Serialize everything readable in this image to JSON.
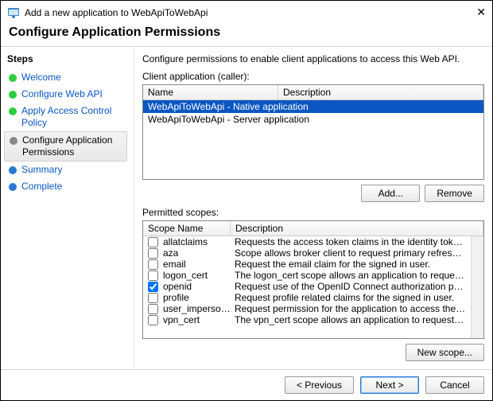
{
  "window": {
    "title": "Add a new application to WebApiToWebApi",
    "close_glyph": "✕"
  },
  "header": "Configure Application Permissions",
  "sidebar": {
    "heading": "Steps",
    "items": [
      {
        "label": "Welcome",
        "state": "done"
      },
      {
        "label": "Configure Web API",
        "state": "done"
      },
      {
        "label": "Apply Access Control Policy",
        "state": "done"
      },
      {
        "label": "Configure Application Permissions",
        "state": "current"
      },
      {
        "label": "Summary",
        "state": "pending"
      },
      {
        "label": "Complete",
        "state": "pending"
      }
    ]
  },
  "main": {
    "instruction": "Configure permissions to enable client applications to access this Web API.",
    "clients_label": "Client application (caller):",
    "clients_columns": {
      "name": "Name",
      "description": "Description"
    },
    "clients": [
      {
        "name": "WebApiToWebApi - Native application",
        "selected": true
      },
      {
        "name": "WebApiToWebApi - Server application",
        "selected": false
      }
    ],
    "add_label": "Add...",
    "remove_label": "Remove",
    "scopes_label": "Permitted scopes:",
    "scopes_columns": {
      "name": "Scope Name",
      "description": "Description"
    },
    "scopes": [
      {
        "name": "allatclaims",
        "checked": false,
        "desc": "Requests the access token claims in the identity token."
      },
      {
        "name": "aza",
        "checked": false,
        "desc": "Scope allows broker client to request primary refresh token."
      },
      {
        "name": "email",
        "checked": false,
        "desc": "Request the email claim for the signed in user."
      },
      {
        "name": "logon_cert",
        "checked": false,
        "desc": "The logon_cert scope allows an application to request logo…"
      },
      {
        "name": "openid",
        "checked": true,
        "desc": "Request use of the OpenID Connect authorization protocol."
      },
      {
        "name": "profile",
        "checked": false,
        "desc": "Request profile related claims for the signed in user."
      },
      {
        "name": "user_imperso…",
        "checked": false,
        "desc": "Request permission for the application to access the resour…"
      },
      {
        "name": "vpn_cert",
        "checked": false,
        "desc": "The vpn_cert scope allows an application to request VPN …"
      }
    ],
    "new_scope_label": "New scope..."
  },
  "footer": {
    "previous": "< Previous",
    "next": "Next >",
    "cancel": "Cancel"
  }
}
